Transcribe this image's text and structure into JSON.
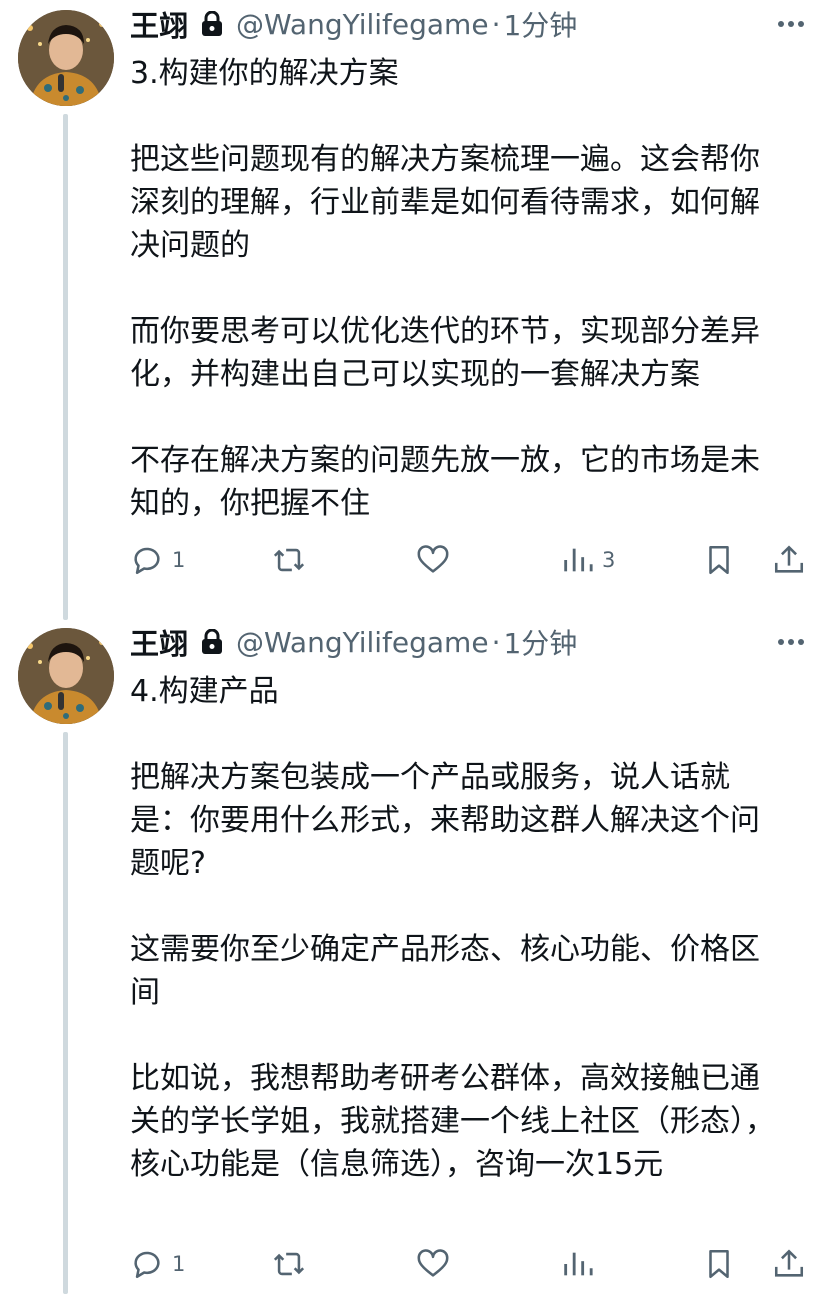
{
  "tweets": [
    {
      "author_name": "王翊",
      "author_handle": "@WangYilifegame",
      "separator": "·",
      "time": "1分钟",
      "text": "3.构建你的解决方案\n\n把这些问题现有的解决方案梳理一遍。这会帮你深刻的理解，行业前辈是如何看待需求，如何解决问题的\n\n而你要思考可以优化迭代的环节，实现部分差异化，并构建出自己可以实现的一套解决方案\n\n不存在解决方案的问题先放一放，它的市场是未知的，你把握不住",
      "reply_count": "1",
      "retweet_count": "",
      "like_count": "",
      "view_count": "3"
    },
    {
      "author_name": "王翊",
      "author_handle": "@WangYilifegame",
      "separator": "·",
      "time": "1分钟",
      "text": "4.构建产品\n\n把解决方案包装成一个产品或服务，说人话就是：你要用什么形式，来帮助这群人解决这个问题呢?\n\n这需要你至少确定产品形态、核心功能、价格区间\n\n比如说，我想帮助考研考公群体，高效接触已通关的学长学姐，我就搭建一个线上社区（形态），核心功能是（信息筛选），咨询一次15元",
      "reply_count": "1",
      "retweet_count": "",
      "like_count": "",
      "view_count": ""
    }
  ],
  "icons": {
    "lock": "lock-icon",
    "more": "more-icon",
    "reply": "reply-icon",
    "retweet": "retweet-icon",
    "like": "like-icon",
    "views": "views-icon",
    "bookmark": "bookmark-icon",
    "share": "share-icon"
  },
  "colors": {
    "text_primary": "#0f1419",
    "text_secondary": "#536471",
    "thread_line": "#cfd9de"
  }
}
